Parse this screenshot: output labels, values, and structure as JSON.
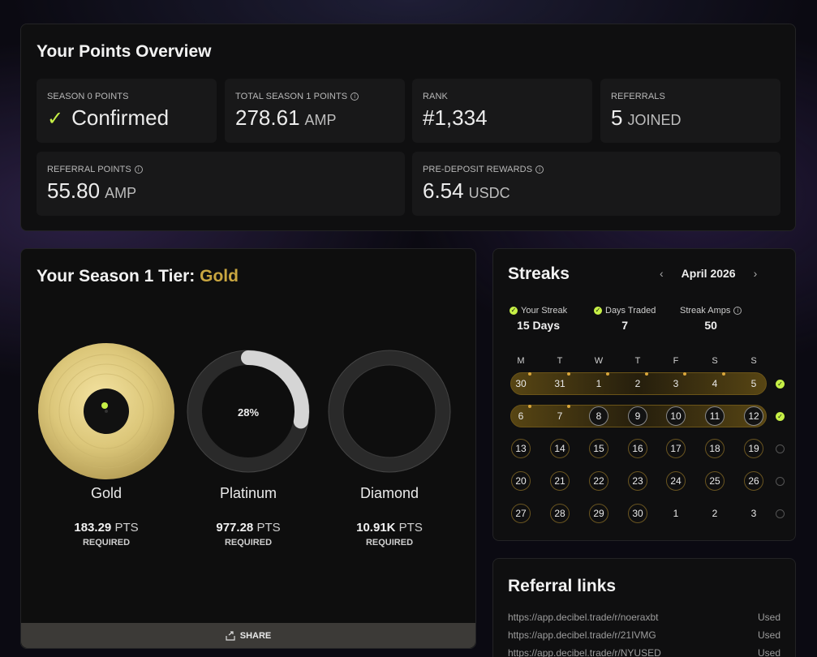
{
  "overview": {
    "title": "Your Points Overview",
    "season0": {
      "label": "SEASON 0 POINTS",
      "value": "Confirmed"
    },
    "total_s1": {
      "label": "TOTAL SEASON 1 POINTS",
      "value": "278.61",
      "unit": "AMP"
    },
    "rank": {
      "label": "RANK",
      "value": "#1,334"
    },
    "referrals": {
      "label": "REFERRALS",
      "value": "5",
      "unit": "JOINED"
    },
    "referral_points": {
      "label": "REFERRAL POINTS",
      "value": "55.80",
      "unit": "AMP"
    },
    "pre_deposit": {
      "label": "PRE-DEPOSIT REWARDS",
      "value": "6.54",
      "unit": "USDC"
    }
  },
  "tier": {
    "title_prefix": "Your Season 1 Tier:",
    "current": "Gold",
    "items": [
      {
        "name": "Gold",
        "pts": "183.29",
        "unit": "PTS",
        "req": "REQUIRED"
      },
      {
        "name": "Platinum",
        "pts": "977.28",
        "unit": "PTS",
        "req": "REQUIRED",
        "progress_label": "28%",
        "progress": 0.28
      },
      {
        "name": "Diamond",
        "pts": "10.91K",
        "unit": "PTS",
        "req": "REQUIRED"
      }
    ],
    "share_label": "SHARE"
  },
  "streaks": {
    "title": "Streaks",
    "month": "April 2026",
    "prev_arrow": "‹",
    "next_arrow": "›",
    "your_streak": {
      "label": "Your Streak",
      "value": "15 Days"
    },
    "days_traded": {
      "label": "Days Traded",
      "value": "7"
    },
    "streak_amps": {
      "label": "Streak Amps",
      "value": "50"
    },
    "dow": [
      "M",
      "T",
      "W",
      "T",
      "F",
      "S",
      "S"
    ],
    "weeks": [
      [
        "30",
        "31",
        "1",
        "2",
        "3",
        "4",
        "5"
      ],
      [
        "6",
        "7",
        "8",
        "9",
        "10",
        "11",
        "12"
      ],
      [
        "13",
        "14",
        "15",
        "16",
        "17",
        "18",
        "19"
      ],
      [
        "20",
        "21",
        "22",
        "23",
        "24",
        "25",
        "26"
      ],
      [
        "27",
        "28",
        "29",
        "30",
        "1",
        "2",
        "3"
      ]
    ]
  },
  "referral_links": {
    "title": "Referral links",
    "items": [
      {
        "url": "https://app.decibel.trade/r/noeraxbt",
        "status": "Used"
      },
      {
        "url": "https://app.decibel.trade/r/21IVMG",
        "status": "Used"
      },
      {
        "url": "https://app.decibel.trade/r/NYUSED",
        "status": "Used"
      }
    ]
  },
  "colors": {
    "accent": "#c6f046",
    "gold": "#c9a640",
    "streak_glow": "#6b5418"
  }
}
